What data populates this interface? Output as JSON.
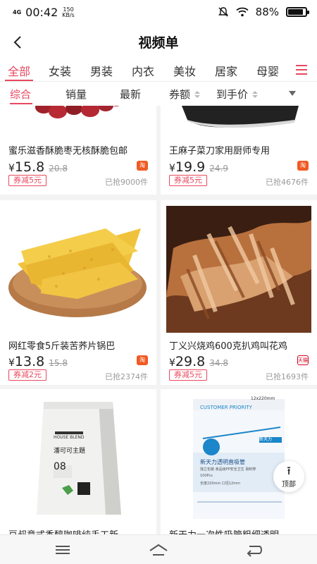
{
  "status_bar": {
    "network": "4G",
    "time": "00:42",
    "speed_value": "150",
    "speed_unit": "KB/s",
    "battery": "88%",
    "battery_level": 0.88,
    "icons": [
      "mute-icon",
      "wifi-icon",
      "battery-icon"
    ]
  },
  "header": {
    "title": "视频单",
    "back_icon": "back-arrow-icon"
  },
  "categories": [
    {
      "label": "全部",
      "active": true
    },
    {
      "label": "女装"
    },
    {
      "label": "男装"
    },
    {
      "label": "内衣"
    },
    {
      "label": "美妆"
    },
    {
      "label": "居家"
    },
    {
      "label": "母婴"
    }
  ],
  "sort_bar": [
    {
      "label": "综合",
      "active": true
    },
    {
      "label": "销量"
    },
    {
      "label": "最新"
    },
    {
      "label": "券额"
    },
    {
      "label": "到手价"
    }
  ],
  "products": [
    {
      "name": "蜜乐滋香酥脆枣无核酥脆包邮",
      "price": "15.8",
      "original_price": "20.8",
      "platform": "淘",
      "coupon": "券减5元",
      "sold": "已抢9000件",
      "image": "red-dates-image"
    },
    {
      "name": "王麻子菜刀家用厨师专用",
      "price": "19.9",
      "original_price": "24.9",
      "platform": "淘",
      "coupon": "券减5元",
      "sold": "已抢4676件",
      "image": "kitchen-knife-image"
    },
    {
      "name": "网红零食5斤装苦荞片锅巴",
      "price": "13.8",
      "original_price": "15.8",
      "platform": "淘",
      "coupon": "券减2元",
      "sold": "已抢2374件",
      "image": "buckwheat-crisps-image"
    },
    {
      "name": "丁义兴烧鸡600克扒鸡叫花鸡",
      "price": "29.8",
      "original_price": "34.8",
      "platform": "天猫",
      "coupon": "券减5元",
      "sold": "已抢1693件",
      "image": "roast-chicken-image"
    },
    {
      "name": "豆叔意式香醇咖啡纯手工新…",
      "image": "coffee-bag-image",
      "bag_brand": "HOUSE BLEND",
      "bag_title": "潘可可主題",
      "bag_number": "08"
    },
    {
      "name": "新天力一次性吸管粗细透明…",
      "image": "straw-box-image",
      "box_size": "12x220mm",
      "box_heading": "CUSTOMER PRIORITY",
      "box_brand": "新天力",
      "box_title": "新天力透明直吸管",
      "box_sub": "独立包装 食品级PP安全卫生 易刺穿",
      "box_count": "100Pcs",
      "box_spec": "长度220mm 口径12mm"
    }
  ],
  "back_to_top": {
    "arrow": "⭱",
    "label": "顶部"
  },
  "yen_symbol": "¥",
  "colors": {
    "accent": "#e8485f",
    "taobao": "#f05a24",
    "tmall": "#d4001c"
  }
}
